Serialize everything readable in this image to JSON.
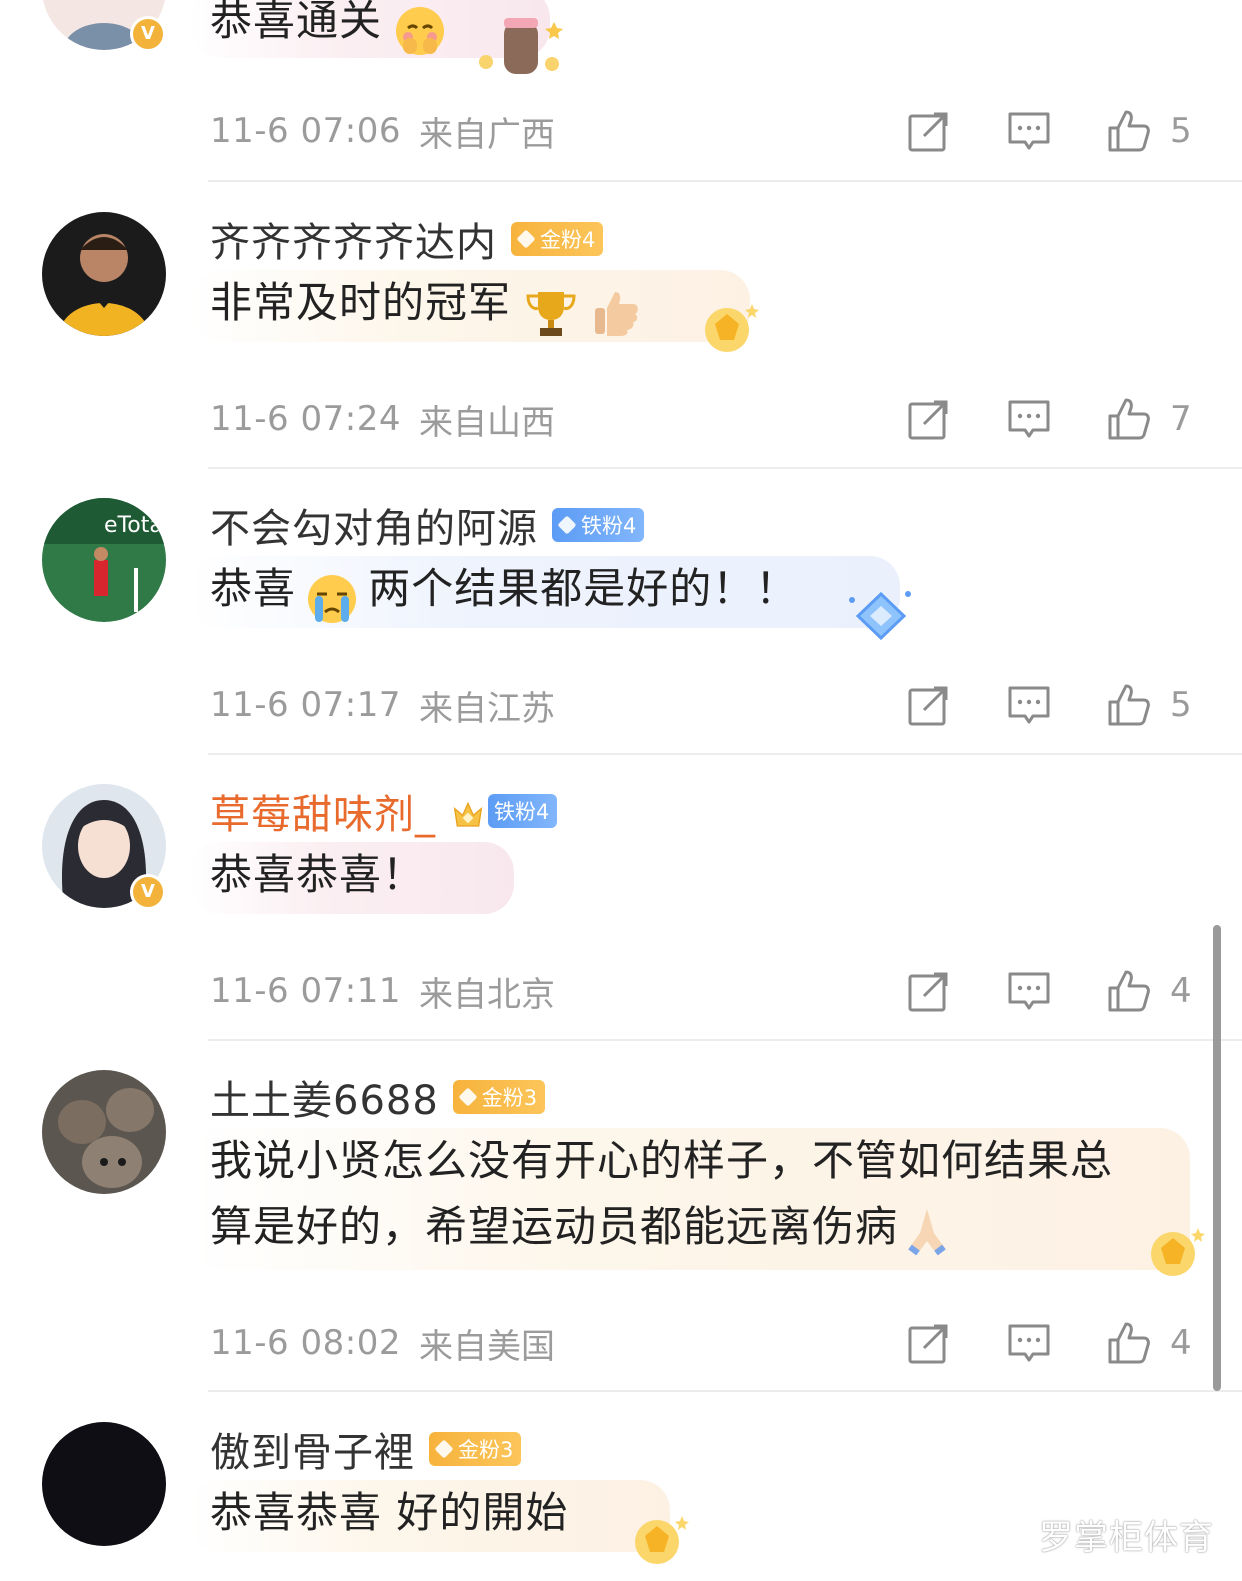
{
  "comments": [
    {
      "username": "",
      "badge": "",
      "content": "恭喜通关",
      "time": "11-6 07:06",
      "location": "来自广西",
      "likes": "5"
    },
    {
      "username": "齐齐齐齐齐达内",
      "badge": "金粉4",
      "content": "非常及时的冠军",
      "time": "11-6 07:24",
      "location": "来自山西",
      "likes": "7"
    },
    {
      "username": "不会勾对角的阿源",
      "badge": "铁粉4",
      "content_a": "恭喜",
      "content_b": "两个结果都是好的！！",
      "time": "11-6 07:17",
      "location": "来自江苏",
      "likes": "5"
    },
    {
      "username": "草莓甜味剂_",
      "badge": "铁粉4",
      "content": "恭喜恭喜！",
      "time": "11-6 07:11",
      "location": "来自北京",
      "likes": "4"
    },
    {
      "username": "土土姜6688",
      "badge": "金粉3",
      "content_line1": "我说小贤怎么没有开心的样子，不管如何结果总",
      "content_line2": "算是好的，希望运动员都能远离伤病",
      "time": "11-6 08:02",
      "location": "来自美国",
      "likes": "4"
    },
    {
      "username": "傲到骨子裡",
      "badge": "金粉3",
      "content": "恭喜恭喜 好的開始"
    }
  ],
  "watermark": "罗掌柜体育",
  "colors": {
    "meta_gray": "#9b9b9b",
    "vip_orange": "#e86a2c",
    "gold_badge": "#f7b33c",
    "iron_badge": "#5c9cf5"
  }
}
